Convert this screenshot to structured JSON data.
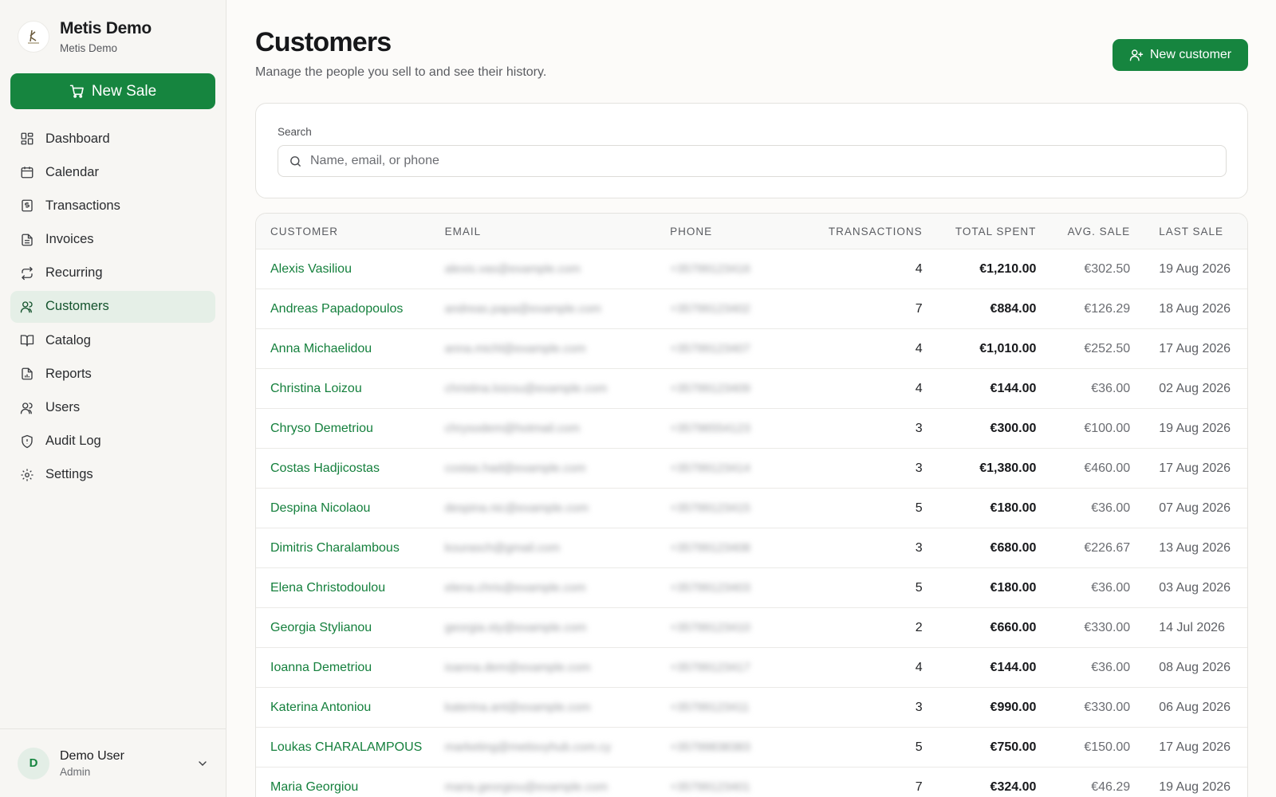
{
  "brand": {
    "title": "Metis Demo",
    "subtitle": "Metis Demo"
  },
  "sidebar": {
    "new_sale_label": "New Sale",
    "items": [
      {
        "label": "Dashboard",
        "icon": "dashboard-icon"
      },
      {
        "label": "Calendar",
        "icon": "calendar-icon"
      },
      {
        "label": "Transactions",
        "icon": "receipt-icon"
      },
      {
        "label": "Invoices",
        "icon": "document-icon"
      },
      {
        "label": "Recurring",
        "icon": "repeat-icon"
      },
      {
        "label": "Customers",
        "icon": "users-icon",
        "active": true
      },
      {
        "label": "Catalog",
        "icon": "book-icon"
      },
      {
        "label": "Reports",
        "icon": "report-icon"
      },
      {
        "label": "Users",
        "icon": "users-icon"
      },
      {
        "label": "Audit Log",
        "icon": "shield-icon"
      },
      {
        "label": "Settings",
        "icon": "gear-icon"
      }
    ]
  },
  "user": {
    "initial": "D",
    "name": "Demo User",
    "role": "Admin"
  },
  "page": {
    "title": "Customers",
    "subtitle": "Manage the people you sell to and see their history.",
    "new_customer_label": "New customer"
  },
  "search": {
    "label": "Search",
    "placeholder": "Name, email, or phone"
  },
  "table": {
    "headers": {
      "customer": "CUSTOMER",
      "email": "EMAIL",
      "phone": "PHONE",
      "transactions": "TRANSACTIONS",
      "total_spent": "TOTAL SPENT",
      "avg_sale": "AVG. SALE",
      "last_sale": "LAST SALE"
    },
    "rows": [
      {
        "name": "Alexis Vasiliou",
        "email": "alexis.vas@example.com",
        "phone": "+35799123416",
        "transactions": "4",
        "total": "€1,210.00",
        "avg": "€302.50",
        "last": "19 Aug 2026"
      },
      {
        "name": "Andreas Papadopoulos",
        "email": "andreas.papa@example.com",
        "phone": "+35799123402",
        "transactions": "7",
        "total": "€884.00",
        "avg": "€126.29",
        "last": "18 Aug 2026"
      },
      {
        "name": "Anna Michaelidou",
        "email": "anna.michl@example.com",
        "phone": "+35799123407",
        "transactions": "4",
        "total": "€1,010.00",
        "avg": "€252.50",
        "last": "17 Aug 2026"
      },
      {
        "name": "Christina Loizou",
        "email": "christina.loizou@example.com",
        "phone": "+35799123409",
        "transactions": "4",
        "total": "€144.00",
        "avg": "€36.00",
        "last": "02 Aug 2026"
      },
      {
        "name": "Chryso Demetriou",
        "email": "chrysodem@hotmail.com",
        "phone": "+35796554123",
        "transactions": "3",
        "total": "€300.00",
        "avg": "€100.00",
        "last": "19 Aug 2026"
      },
      {
        "name": "Costas Hadjicostas",
        "email": "costas.had@example.com",
        "phone": "+35799123414",
        "transactions": "3",
        "total": "€1,380.00",
        "avg": "€460.00",
        "last": "17 Aug 2026"
      },
      {
        "name": "Despina Nicolaou",
        "email": "despina.nic@example.com",
        "phone": "+35799123415",
        "transactions": "5",
        "total": "€180.00",
        "avg": "€36.00",
        "last": "07 Aug 2026"
      },
      {
        "name": "Dimitris Charalambous",
        "email": "kourasch@gmail.com",
        "phone": "+35799123408",
        "transactions": "3",
        "total": "€680.00",
        "avg": "€226.67",
        "last": "13 Aug 2026"
      },
      {
        "name": "Elena Christodoulou",
        "email": "elena.chris@example.com",
        "phone": "+35799123403",
        "transactions": "5",
        "total": "€180.00",
        "avg": "€36.00",
        "last": "03 Aug 2026"
      },
      {
        "name": "Georgia Stylianou",
        "email": "georgia.sty@example.com",
        "phone": "+35799123410",
        "transactions": "2",
        "total": "€660.00",
        "avg": "€330.00",
        "last": "14 Jul 2026"
      },
      {
        "name": "Ioanna Demetriou",
        "email": "ioanna.dem@example.com",
        "phone": "+35799123417",
        "transactions": "4",
        "total": "€144.00",
        "avg": "€36.00",
        "last": "08 Aug 2026"
      },
      {
        "name": "Katerina Antoniou",
        "email": "katerina.ant@example.com",
        "phone": "+35799123411",
        "transactions": "3",
        "total": "€990.00",
        "avg": "€330.00",
        "last": "06 Aug 2026"
      },
      {
        "name": "Loukas CHARALAMPOUS",
        "email": "marketing@metisvyhub.com.cy",
        "phone": "+35799838383",
        "transactions": "5",
        "total": "€750.00",
        "avg": "€150.00",
        "last": "17 Aug 2026"
      },
      {
        "name": "Maria Georgiou",
        "email": "maria.georgiou@example.com",
        "phone": "+35799123401",
        "transactions": "7",
        "total": "€324.00",
        "avg": "€46.29",
        "last": "19 Aug 2026"
      }
    ]
  },
  "colors": {
    "accent": "#16853f",
    "link": "#15803d",
    "active_nav_bg": "#e5efe7"
  }
}
